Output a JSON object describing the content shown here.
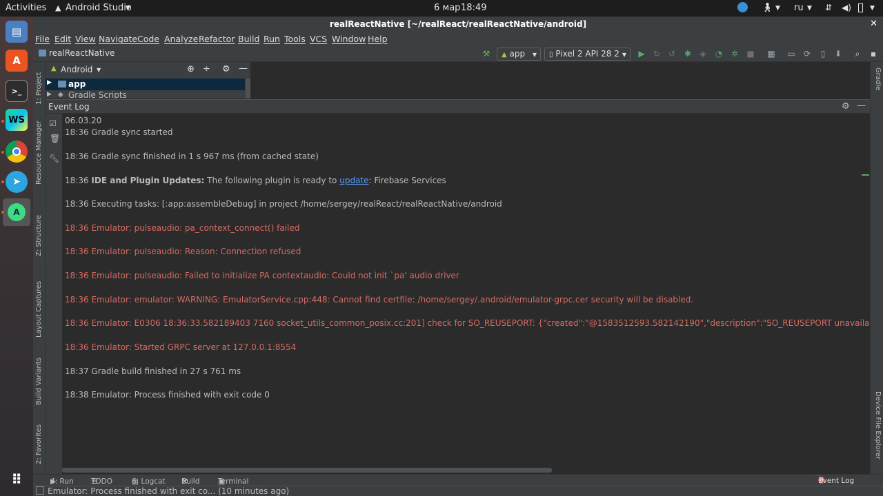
{
  "topbar": {
    "activities": "Activities",
    "app_name": "Android Studio",
    "date": "6 мар",
    "time": "18:49",
    "lang": "ru"
  },
  "window": {
    "title": "realReactNative [~/realReact/realReactNative/android]"
  },
  "menu": [
    "File",
    "Edit",
    "View",
    "Navigate",
    "Code",
    "Analyze",
    "Refactor",
    "Build",
    "Run",
    "Tools",
    "VCS",
    "Window",
    "Help"
  ],
  "navbar": {
    "breadcrumb": "realReactNative",
    "config": "app",
    "device": "Pixel 2 API 28 2"
  },
  "left_tabs": [
    "1: Project",
    "Resource Manager",
    "Z: Structure",
    "Layout Captures",
    "Build Variants",
    "2: Favorites"
  ],
  "right_tabs": [
    "Gradle",
    "Device File Explorer"
  ],
  "project": {
    "view_mode": "Android",
    "items": [
      "app",
      "Gradle Scripts"
    ]
  },
  "event_log": {
    "title": "Event Log",
    "date": "06.03.20",
    "lines": [
      {
        "text": "18:36 Gradle sync started",
        "type": "info"
      },
      {
        "text": "18:36 Gradle sync finished in 1 s 967 ms (from cached state)",
        "type": "info"
      },
      {
        "time": "18:36",
        "bold": "IDE and Plugin Updates:",
        "pre": "The following plugin is ready to",
        "link": "update",
        "post": ": Firebase Services",
        "type": "update"
      },
      {
        "text": "18:36 Executing tasks: [:app:assembleDebug] in project /home/sergey/realReact/realReactNative/android",
        "type": "info"
      },
      {
        "text": "18:36 Emulator: pulseaudio: pa_context_connect() failed",
        "type": "error"
      },
      {
        "text": "18:36 Emulator: pulseaudio: Reason: Connection refused",
        "type": "error"
      },
      {
        "text": "18:36 Emulator: pulseaudio: Failed to initialize PA contextaudio: Could not init `pa' audio driver",
        "type": "error"
      },
      {
        "text": "18:36 Emulator: emulator: WARNING: EmulatorService.cpp:448: Cannot find certfile: /home/sergey/.android/emulator-grpc.cer security will be disabled.",
        "type": "error"
      },
      {
        "text": "18:36 Emulator: E0306 18:36:33.582189403    7160 socket_utils_common_posix.cc:201] check for SO_REUSEPORT: {\"created\":\"@1583512593.582142190\",\"description\":\"SO_REUSEPORT unavailable on compiling system",
        "type": "error"
      },
      {
        "text": "18:36 Emulator: Started GRPC server at 127.0.0.1:8554",
        "type": "error"
      },
      {
        "text": "18:37 Gradle build finished in 27 s 761 ms",
        "type": "info"
      },
      {
        "text": "18:38 Emulator: Process finished with exit code 0",
        "type": "info"
      }
    ]
  },
  "bottom_tabs": {
    "run": "4: Run",
    "todo": "TODO",
    "logcat": "6: Logcat",
    "build": "Build",
    "terminal": "Terminal",
    "event_log": "Event Log",
    "event_count": "8"
  },
  "status": {
    "message": "Emulator: Process finished with exit co... (10 minutes ago)"
  },
  "colors": {
    "ide_bg": "#2b2b2b",
    "panel_bg": "#3c3f41",
    "error_text": "#d56b62",
    "link": "#589df6",
    "android_green": "#a4c639"
  }
}
